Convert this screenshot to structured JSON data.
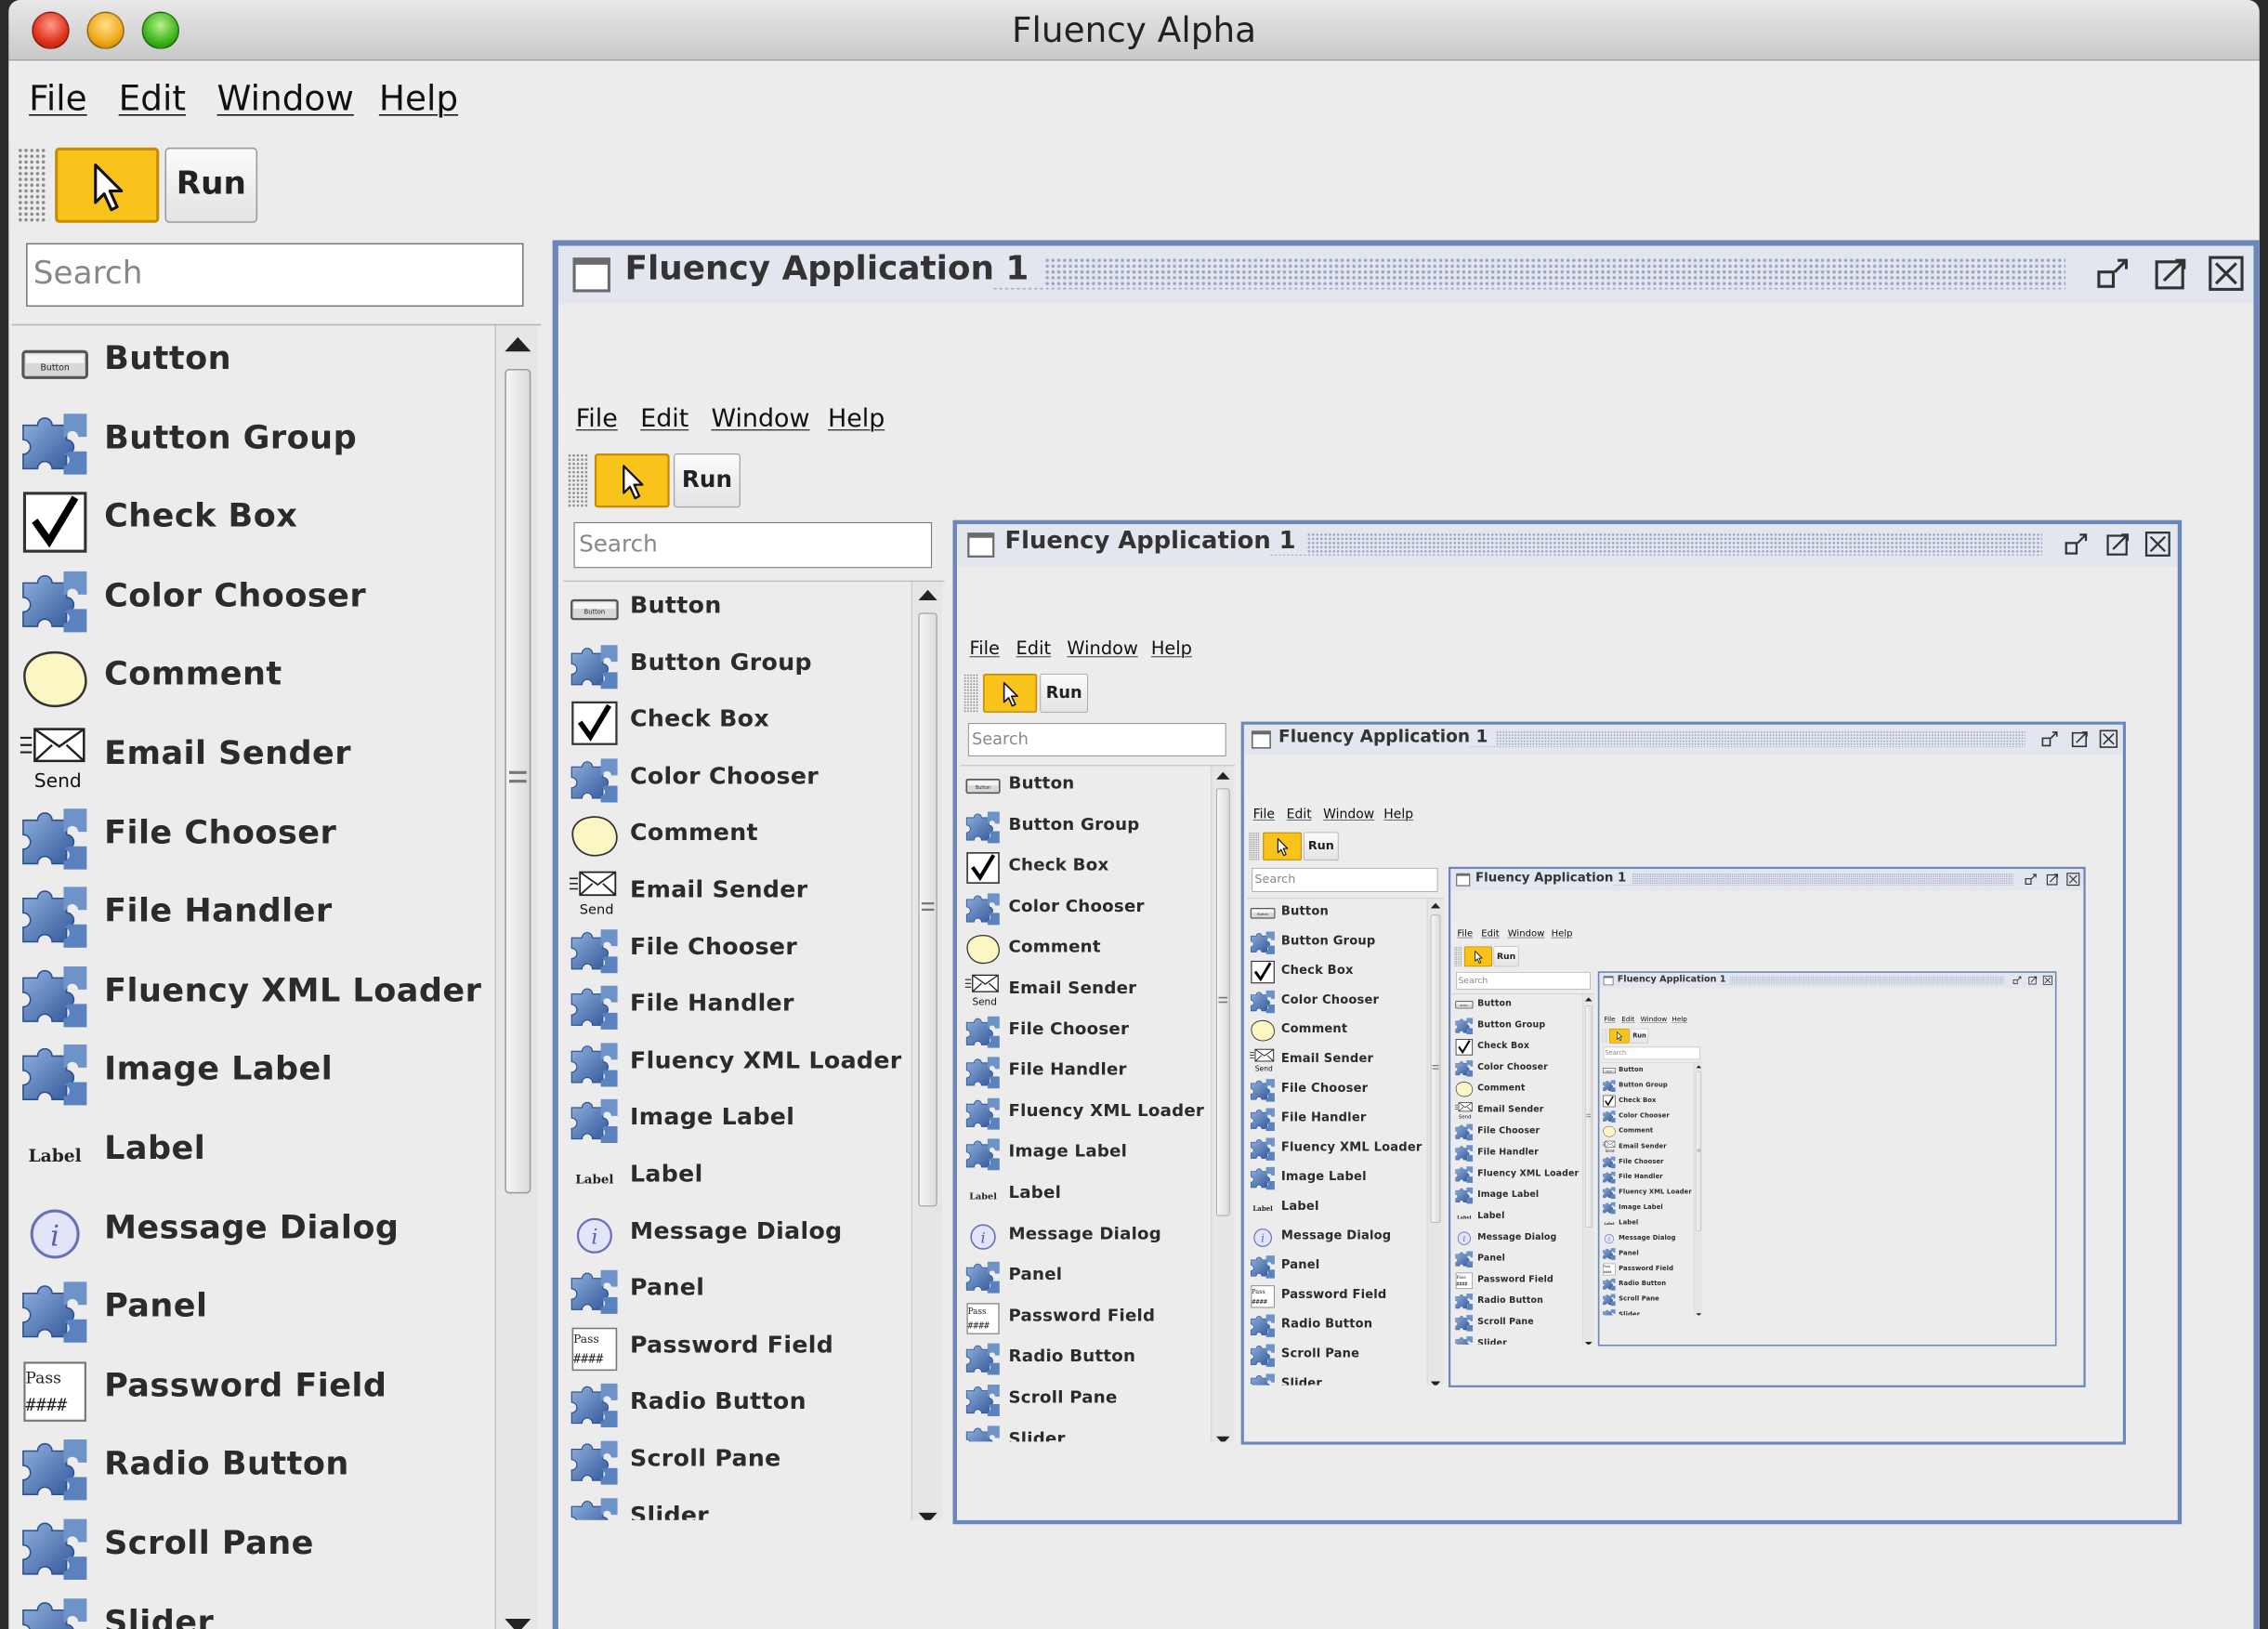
{
  "window_title": "Fluency Alpha",
  "menus": [
    "File",
    "Edit",
    "Window",
    "Help"
  ],
  "toolbar": {
    "run_label": "Run",
    "select_tool": "arrow-pointer-icon"
  },
  "search": {
    "placeholder": "Search"
  },
  "palette": [
    {
      "label": "Button",
      "icon": "button-icon"
    },
    {
      "label": "Button Group",
      "icon": "puzzle-icon"
    },
    {
      "label": "Check Box",
      "icon": "checkmark-icon"
    },
    {
      "label": "Color Chooser",
      "icon": "puzzle-icon"
    },
    {
      "label": "Comment",
      "icon": "speech-bubble-icon"
    },
    {
      "label": "Email Sender",
      "icon": "envelope-send-icon"
    },
    {
      "label": "File Chooser",
      "icon": "puzzle-icon"
    },
    {
      "label": "File Handler",
      "icon": "puzzle-icon"
    },
    {
      "label": "Fluency XML Loader",
      "icon": "puzzle-icon"
    },
    {
      "label": "Image Label",
      "icon": "puzzle-icon"
    },
    {
      "label": "Label",
      "icon": "label-icon"
    },
    {
      "label": "Message Dialog",
      "icon": "info-icon"
    },
    {
      "label": "Panel",
      "icon": "puzzle-icon"
    },
    {
      "label": "Password Field",
      "icon": "password-icon"
    },
    {
      "label": "Radio Button",
      "icon": "puzzle-icon"
    },
    {
      "label": "Scroll Pane",
      "icon": "puzzle-icon"
    },
    {
      "label": "Slider",
      "icon": "puzzle-icon"
    }
  ],
  "internal_window": {
    "title": "Fluency Application 1"
  },
  "icon_text": {
    "button": "Button",
    "send": "Send",
    "label": "Label",
    "pass": "Pass"
  },
  "colors": {
    "accent": "#f8c41c",
    "frame_border": "#6b86b8",
    "puzzle": "#4a74b4"
  }
}
